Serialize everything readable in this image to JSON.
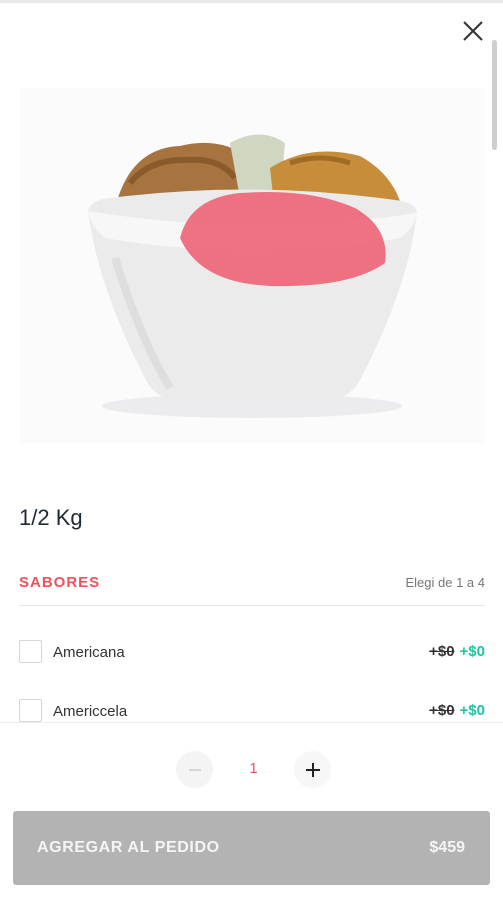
{
  "product": {
    "title": "1/2 Kg",
    "image_icon": "ice-cream-bowl-image"
  },
  "section": {
    "title": "SABORES",
    "hint": "Elegi de 1 a 4"
  },
  "options": [
    {
      "label": "Americana",
      "old_price": "+$0",
      "new_price": "+$0",
      "checked": false
    },
    {
      "label": "Americcela",
      "old_price": "+$0",
      "new_price": "+$0",
      "checked": false
    }
  ],
  "quantity": {
    "value": "1",
    "minus_icon": "minus-icon",
    "plus_icon": "plus-icon"
  },
  "add_button": {
    "label": "AGREGAR AL PEDIDO",
    "price": "$459"
  },
  "colors": {
    "accent": "#f0515f",
    "price_green": "#21c4a2",
    "button_disabled": "#b3b3b3"
  }
}
